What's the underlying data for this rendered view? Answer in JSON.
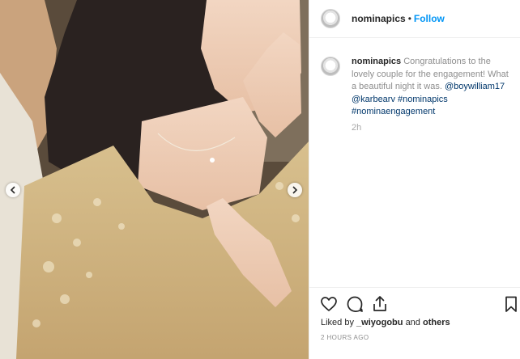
{
  "post": {
    "username": "nominapics",
    "separator": "•",
    "follow_label": "Follow"
  },
  "caption": {
    "username": "nominapics",
    "text_line1": "Congratulations to the lovely couple for the engagement! What a beautiful night it was.",
    "mention1": "@boywilliam17",
    "mention2": "@karbearv",
    "hashtag1": "#nominapics",
    "hashtag2": "#nominaengagement",
    "relative_time": "2h"
  },
  "likes": {
    "prefix": "Liked by",
    "user": "_wiyogobu",
    "middle": "and",
    "suffix": "others"
  },
  "timestamp": "2 HOURS AGO",
  "icons": {
    "like": "heart-icon",
    "comment": "comment-icon",
    "share": "share-icon",
    "save": "bookmark-icon",
    "prev": "chevron-left-icon",
    "next": "chevron-right-icon"
  },
  "colors": {
    "follow": "#0095f6",
    "link": "#00376b",
    "muted": "#8e8e8e"
  }
}
